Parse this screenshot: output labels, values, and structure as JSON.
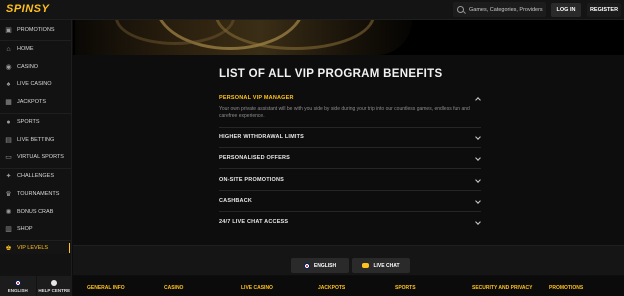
{
  "header": {
    "logo": "SPINSY",
    "search_placeholder": "Games, Categories, Providers",
    "login_label": "LOG IN",
    "register_label": "REGISTER"
  },
  "sidebar": {
    "items": [
      {
        "label": "PROMOTIONS",
        "icon": "gift-icon"
      },
      {
        "label": "HOME",
        "icon": "home-icon"
      },
      {
        "label": "CASINO",
        "icon": "casino-chip-icon"
      },
      {
        "label": "LIVE CASINO",
        "icon": "live-casino-icon"
      },
      {
        "label": "JACKPOTS",
        "icon": "jackpot-icon"
      },
      {
        "label": "SPORTS",
        "icon": "sports-ball-icon"
      },
      {
        "label": "LIVE BETTING",
        "icon": "live-betting-icon"
      },
      {
        "label": "VIRTUAL SPORTS",
        "icon": "virtual-sports-icon"
      },
      {
        "label": "CHALLENGES",
        "icon": "challenges-icon"
      },
      {
        "label": "TOURNAMENTS",
        "icon": "trophy-icon"
      },
      {
        "label": "BONUS CRAB",
        "icon": "crab-icon"
      },
      {
        "label": "SHOP",
        "icon": "shop-icon"
      },
      {
        "label": "VIP LEVELS",
        "icon": "vip-crown-icon",
        "active": true
      }
    ],
    "bottom": {
      "english_label": "ENGLISH",
      "help_label": "HELP CENTRE"
    }
  },
  "main": {
    "title": "LIST OF ALL VIP PROGRAM BENEFITS",
    "accordion": [
      {
        "label": "PERSONAL VIP MANAGER",
        "open": true,
        "body": "Your own private assistant will be with you side by side during your trip into our countless games, endless fun and carefree experience."
      },
      {
        "label": "HIGHER WITHDRAWAL LIMITS",
        "open": false
      },
      {
        "label": "PERSONALISED OFFERS",
        "open": false
      },
      {
        "label": "ON-SITE PROMOTIONS",
        "open": false
      },
      {
        "label": "CASHBACK",
        "open": false
      },
      {
        "label": "24/7 LIVE CHAT ACCESS",
        "open": false
      }
    ]
  },
  "bar": {
    "language_label": "ENGLISH",
    "chat_label": "LIVE CHAT"
  },
  "footer": {
    "links": [
      "GENERAL INFO",
      "CASINO",
      "LIVE CASINO",
      "JACKPOTS",
      "SPORTS",
      "SECURITY AND PRIVACY",
      "PROMOTIONS"
    ]
  },
  "colors": {
    "accent": "#ffc11e",
    "background": "#0d0d0d",
    "sidebar": "#121212"
  }
}
